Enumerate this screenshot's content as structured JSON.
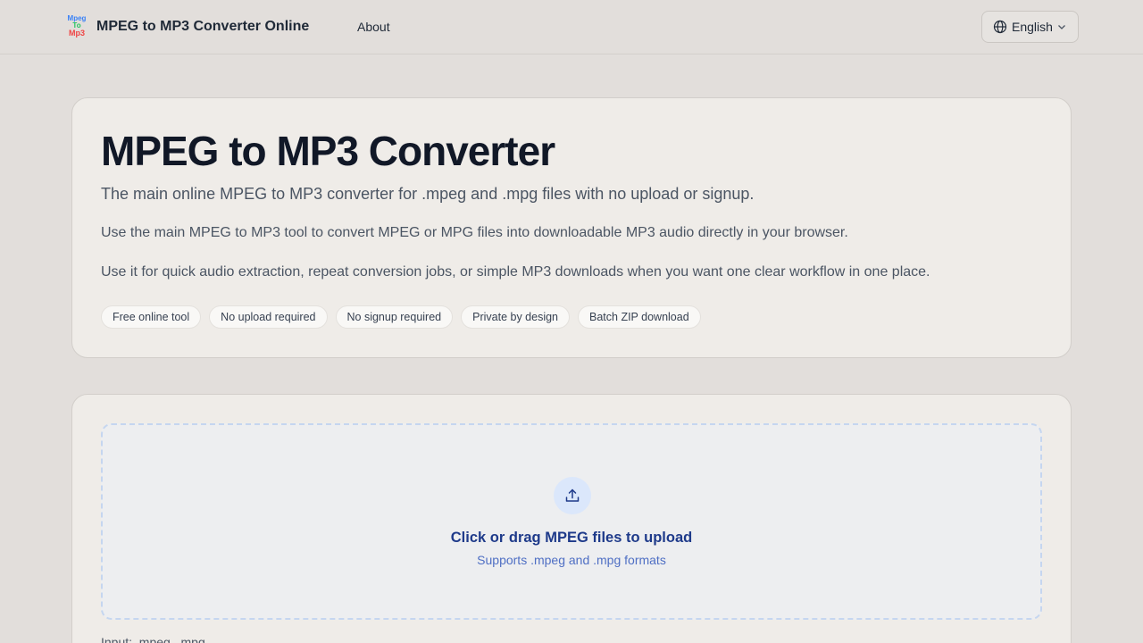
{
  "header": {
    "logo": {
      "line1": "Mpeg",
      "line2": "To",
      "line3": "Mp3"
    },
    "brand": "MPEG to MP3 Converter Online",
    "nav_about": "About",
    "language": "English"
  },
  "hero": {
    "title": "MPEG to MP3 Converter",
    "subtitle": "The main online MPEG to MP3 converter for .mpeg and .mpg files with no upload or signup.",
    "paragraph1": "Use the main MPEG to MP3 tool to convert MPEG or MPG files into downloadable MP3 audio directly in your browser.",
    "paragraph2": "Use it for quick audio extraction, repeat conversion jobs, or simple MP3 downloads when you want one clear workflow in one place.",
    "badges": [
      "Free online tool",
      "No upload required",
      "No signup required",
      "Private by design",
      "Batch ZIP download"
    ]
  },
  "upload": {
    "title": "Click or drag MPEG files to upload",
    "subtitle": "Supports .mpeg and .mpg formats",
    "input_note": "Input: .mpeg, .mpg"
  },
  "colors": {
    "background": "#e2dedb",
    "card": "#efece8",
    "accent": "#1e3a8a",
    "dropzone_border": "#c5d6f0"
  }
}
